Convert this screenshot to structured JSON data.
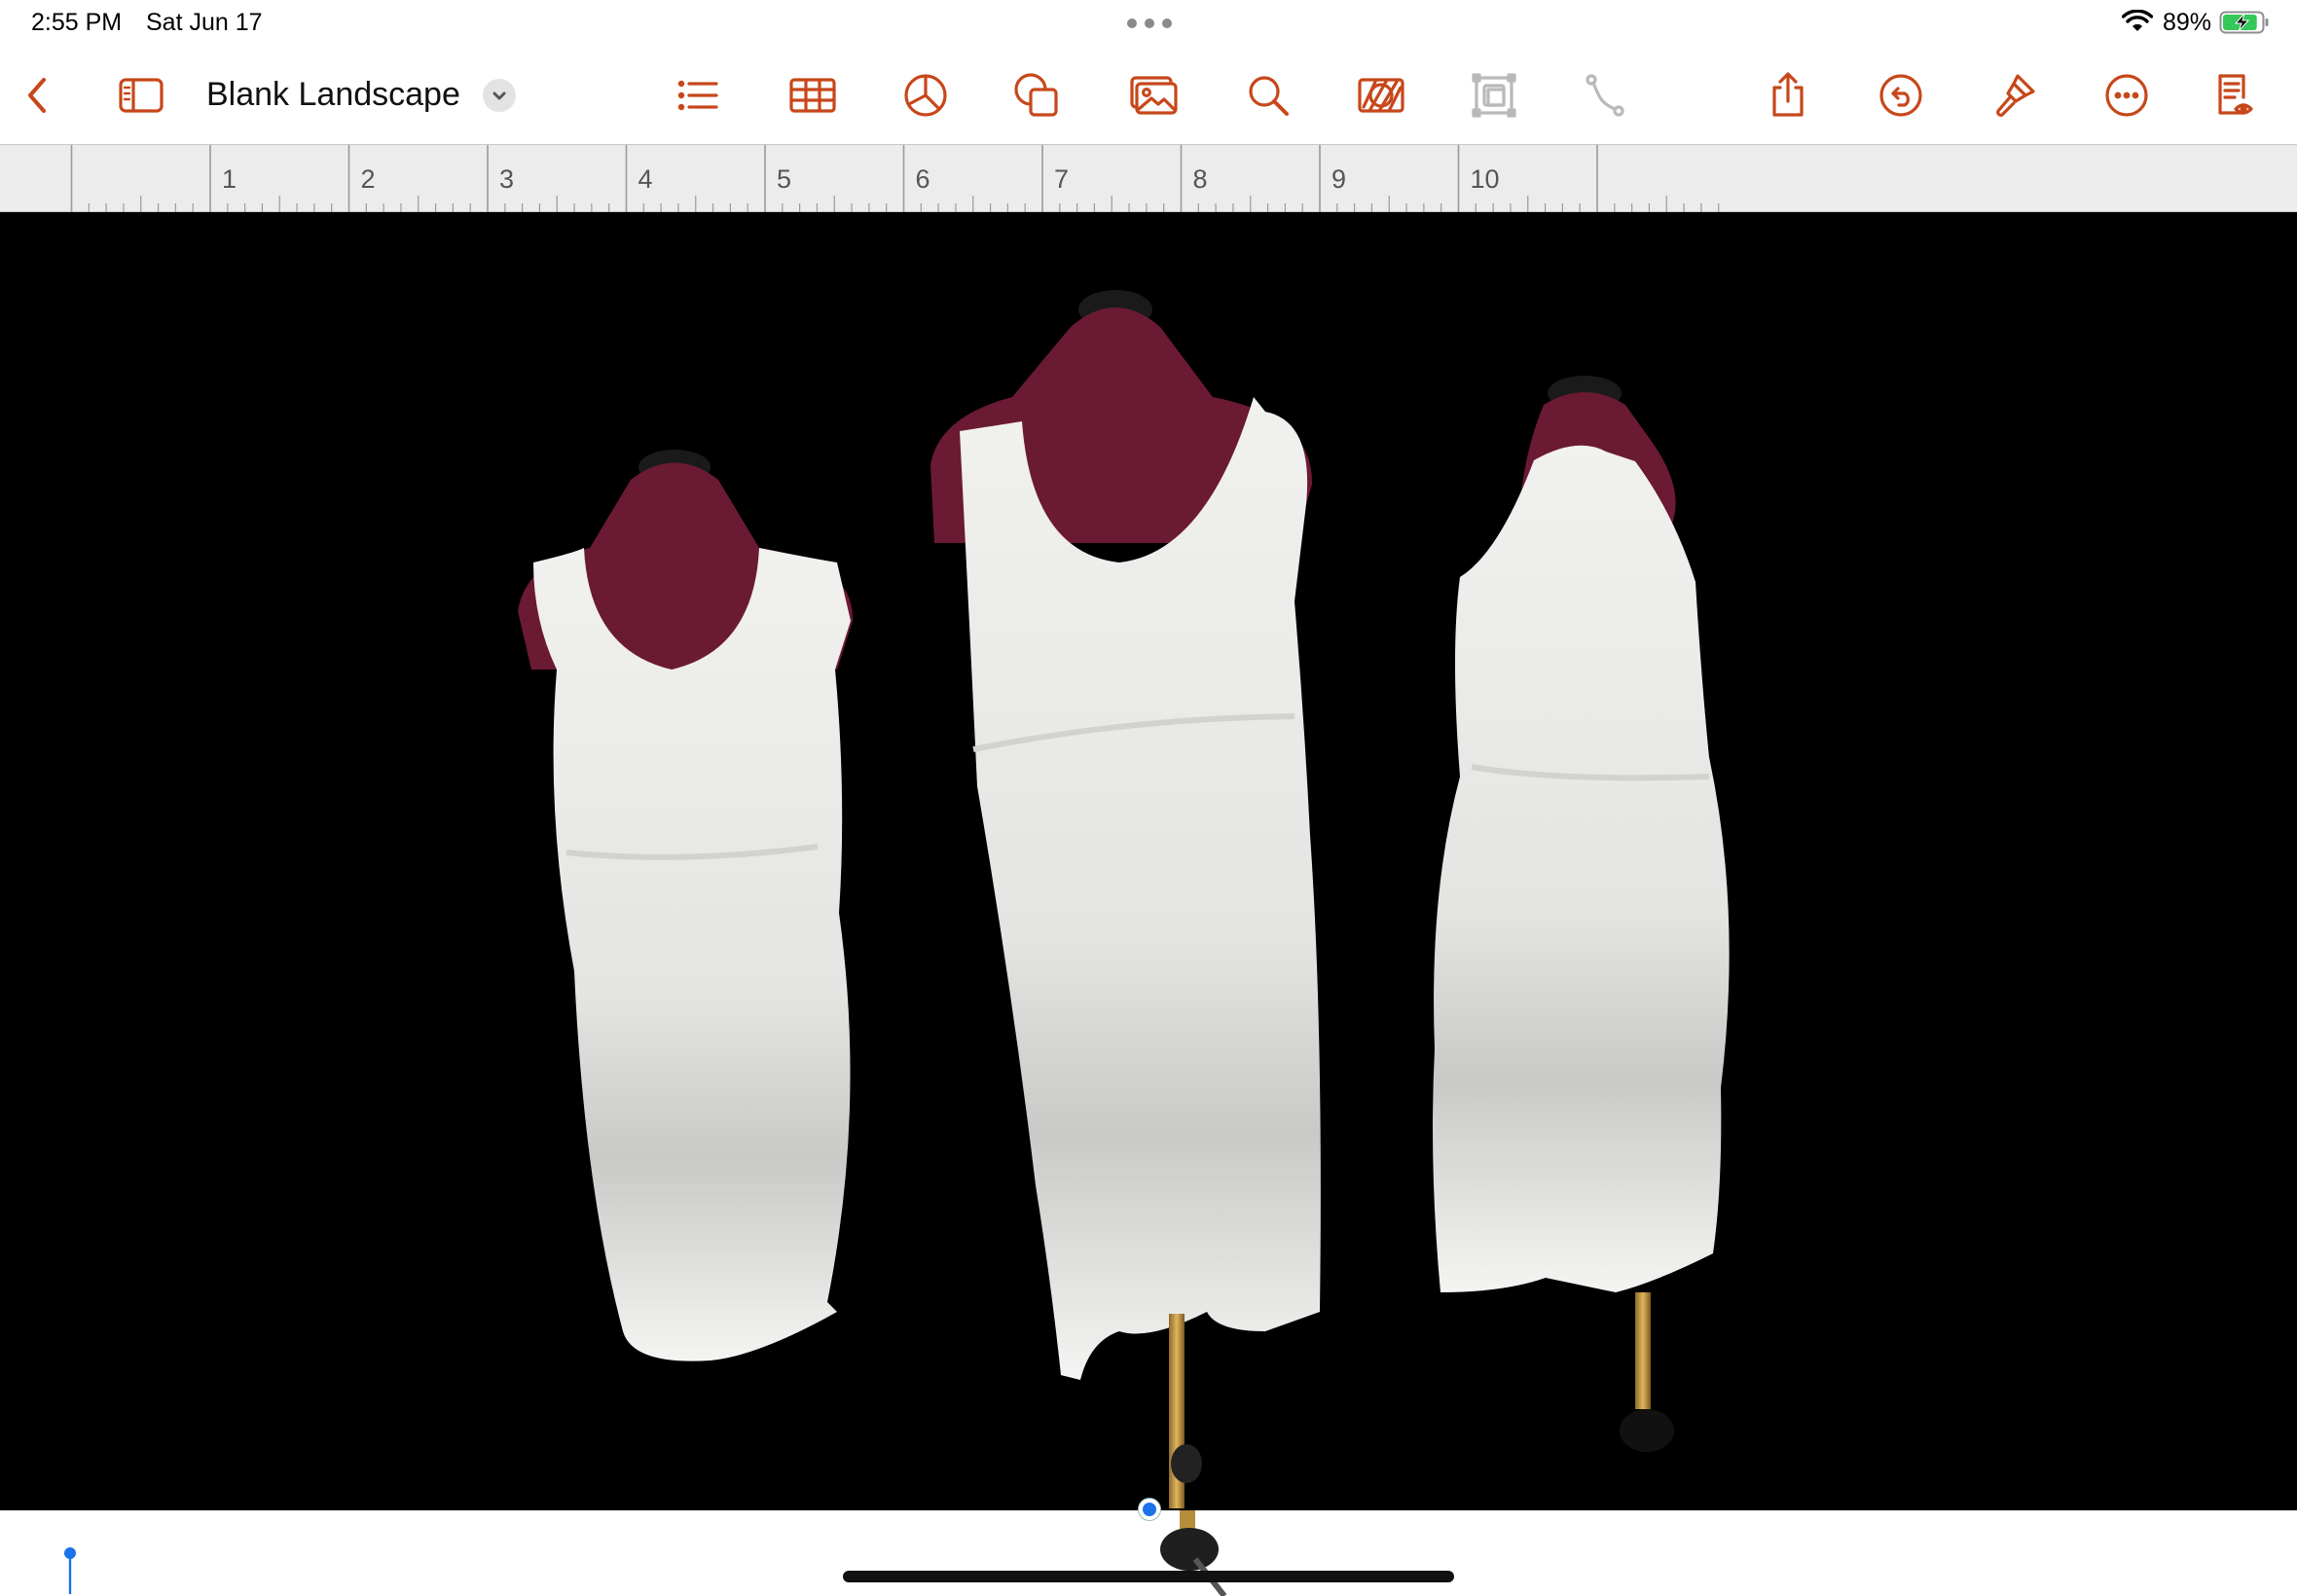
{
  "status_bar": {
    "time": "2:55 PM",
    "date": "Sat Jun 17",
    "battery_percent": "89%",
    "battery_level": 0.89,
    "charging": true
  },
  "toolbar": {
    "document_title": "Blank Landscape",
    "buttons": [
      {
        "name": "back-button",
        "icon": "chevron-left-icon"
      },
      {
        "name": "sidebar-button",
        "icon": "sidebar-icon"
      },
      {
        "name": "title-menu-button",
        "icon": "chevron-down-icon"
      },
      {
        "name": "format-list-button",
        "icon": "list-icon"
      },
      {
        "name": "insert-table-button",
        "icon": "table-icon"
      },
      {
        "name": "insert-chart-button",
        "icon": "pie-chart-icon"
      },
      {
        "name": "insert-shape-button",
        "icon": "shapes-icon"
      },
      {
        "name": "insert-media-button",
        "icon": "photo-icon"
      },
      {
        "name": "search-button",
        "icon": "search-icon"
      },
      {
        "name": "instant-alpha-button",
        "icon": "instant-alpha-icon"
      },
      {
        "name": "arrange-button",
        "icon": "arrange-icon",
        "disabled": true
      },
      {
        "name": "connection-line-button",
        "icon": "connection-icon",
        "disabled": true
      },
      {
        "name": "share-button",
        "icon": "share-icon"
      },
      {
        "name": "undo-button",
        "icon": "undo-icon"
      },
      {
        "name": "format-brush-button",
        "icon": "paintbrush-icon"
      },
      {
        "name": "more-button",
        "icon": "ellipsis-icon"
      },
      {
        "name": "reading-view-button",
        "icon": "document-view-icon"
      }
    ]
  },
  "ruler": {
    "labels": [
      "1",
      "2",
      "3",
      "4",
      "5",
      "6",
      "7",
      "8",
      "9",
      "10"
    ]
  },
  "colors": {
    "accent": "#c7471a",
    "canvas_bg": "#000000",
    "ruler_bg": "#ececec",
    "selection_blue": "#1a73e8",
    "battery_green": "#34c759"
  },
  "canvas": {
    "image_description_icon": "dress-form-photo"
  }
}
